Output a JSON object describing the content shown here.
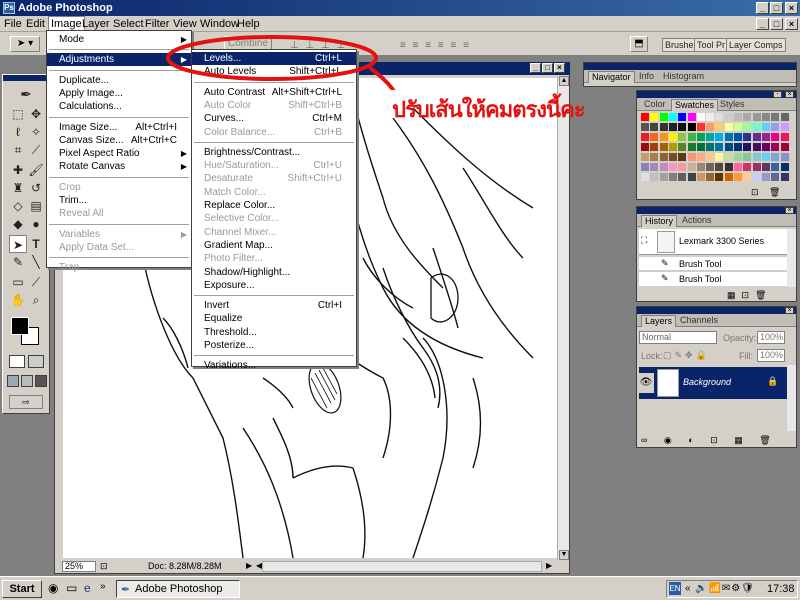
{
  "window": {
    "title": "Adobe Photoshop",
    "controls": [
      "_",
      "□",
      "×"
    ]
  },
  "menubar": [
    "File",
    "Edit",
    "Image",
    "Layer",
    "Select",
    "Filter",
    "View",
    "Window",
    "Help"
  ],
  "options": {
    "combine": "Combine",
    "panel_tabs": [
      "Brushes",
      "Tool Pr",
      "Layer Comps"
    ]
  },
  "image_menu": {
    "items": [
      {
        "label": "Mode",
        "submenu": true
      },
      {
        "label": "Adjustments",
        "submenu": true,
        "highlight": true
      },
      {
        "label": "Duplicate..."
      },
      {
        "label": "Apply Image..."
      },
      {
        "label": "Calculations..."
      },
      {
        "label": "Image Size...",
        "shortcut": "Alt+Ctrl+I"
      },
      {
        "label": "Canvas Size...",
        "shortcut": "Alt+Ctrl+C"
      },
      {
        "label": "Pixel Aspect Ratio",
        "submenu": true
      },
      {
        "label": "Rotate Canvas",
        "submenu": true
      },
      {
        "label": "Crop",
        "disabled": true
      },
      {
        "label": "Trim..."
      },
      {
        "label": "Reveal All",
        "disabled": true
      },
      {
        "label": "Variables",
        "submenu": true,
        "disabled": true
      },
      {
        "label": "Apply Data Set...",
        "disabled": true
      },
      {
        "label": "Trap...",
        "disabled": true
      }
    ]
  },
  "adjust_menu": {
    "items": [
      {
        "label": "Levels...",
        "shortcut": "Ctrl+L",
        "highlight": true
      },
      {
        "label": "Auto Levels",
        "shortcut": "Shift+Ctrl+L"
      },
      {
        "label": "Auto Contrast",
        "shortcut": "Alt+Shift+Ctrl+L"
      },
      {
        "label": "Auto Color",
        "shortcut": "Shift+Ctrl+B",
        "disabled": true
      },
      {
        "label": "Curves...",
        "shortcut": "Ctrl+M"
      },
      {
        "label": "Color Balance...",
        "shortcut": "Ctrl+B",
        "disabled": true
      },
      {
        "label": "Brightness/Contrast..."
      },
      {
        "label": "Hue/Saturation...",
        "shortcut": "Ctrl+U",
        "disabled": true
      },
      {
        "label": "Desaturate",
        "shortcut": "Shift+Ctrl+U",
        "disabled": true
      },
      {
        "label": "Match Color...",
        "disabled": true
      },
      {
        "label": "Replace Color..."
      },
      {
        "label": "Selective Color...",
        "disabled": true
      },
      {
        "label": "Channel Mixer...",
        "disabled": true
      },
      {
        "label": "Gradient Map..."
      },
      {
        "label": "Photo Filter...",
        "disabled": true
      },
      {
        "label": "Shadow/Highlight..."
      },
      {
        "label": "Exposure..."
      },
      {
        "label": "Invert",
        "shortcut": "Ctrl+I"
      },
      {
        "label": "Equalize"
      },
      {
        "label": "Threshold..."
      },
      {
        "label": "Posterize..."
      },
      {
        "label": "Variations..."
      }
    ]
  },
  "annotation": "ปรับเส้นให้คมตรงนี้คะ",
  "doc": {
    "zoom": "25%",
    "info": "Doc: 8.28M/8.28M"
  },
  "navigator": {
    "tabs": [
      "Navigator",
      "Info",
      "Histogram"
    ]
  },
  "swatches": {
    "tabs": [
      "Color",
      "Swatches",
      "Styles"
    ]
  },
  "history": {
    "tabs": [
      "History",
      "Actions"
    ],
    "snapshot": "Lexmark 3300 Series",
    "states": [
      "Brush Tool",
      "Brush Tool"
    ]
  },
  "layers": {
    "tabs": [
      "Layers",
      "Channels"
    ],
    "blend_mode": "Normal",
    "opacity_label": "Opacity:",
    "opacity": "100%",
    "lock_label": "Lock:",
    "fill_label": "Fill:",
    "fill": "100%",
    "layer_name": "Background"
  },
  "taskbar": {
    "start": "Start",
    "task": "Adobe Photoshop",
    "lang": "EN",
    "clock": "17:38"
  },
  "colors": {
    "menu_highlight": "#0a246a",
    "annotation": "#e41111"
  }
}
